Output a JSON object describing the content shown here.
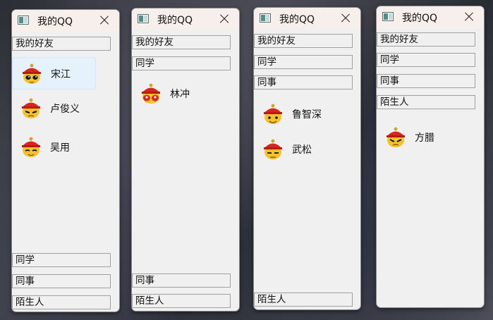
{
  "windows": [
    {
      "title": "我的QQ",
      "top_groups": [
        "我的好友"
      ],
      "friends": [
        {
          "name": "宋江",
          "selected": true
        },
        {
          "name": "卢俊义",
          "selected": false
        },
        {
          "name": "吴用",
          "selected": false
        }
      ],
      "bottom_groups": [
        "同学",
        "同事",
        "陌生人"
      ]
    },
    {
      "title": "我的QQ",
      "top_groups": [
        "我的好友",
        "同学"
      ],
      "friends": [
        {
          "name": "林冲",
          "selected": false
        }
      ],
      "bottom_groups": [
        "同事",
        "陌生人"
      ]
    },
    {
      "title": "我的QQ",
      "top_groups": [
        "我的好友",
        "同学",
        "同事"
      ],
      "friends": [
        {
          "name": "鲁智深",
          "selected": false
        },
        {
          "name": "武松",
          "selected": false
        }
      ],
      "bottom_groups": [
        "陌生人"
      ]
    },
    {
      "title": "我的QQ",
      "top_groups": [
        "我的好友",
        "同学",
        "同事",
        "陌生人"
      ],
      "friends": [
        {
          "name": "方腊",
          "selected": false
        }
      ],
      "bottom_groups": []
    }
  ],
  "icons": {
    "app": "window-icon",
    "close": "close-icon",
    "avatar": "qq-avatar-icon"
  }
}
